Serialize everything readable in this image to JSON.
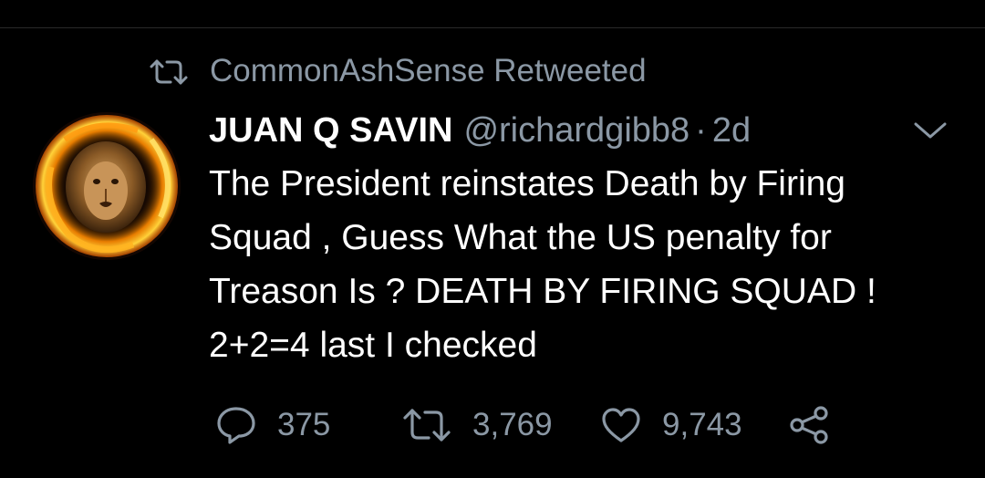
{
  "retweet_context": {
    "icon": "retweet-icon",
    "text": "CommonAshSense Retweeted"
  },
  "tweet": {
    "avatar": "lion-flame-avatar",
    "display_name": "JUAN Q SAVIN",
    "handle": "@richardgibb8",
    "separator": "·",
    "timestamp": "2d",
    "menu_icon": "chevron-down-icon",
    "text_lines": [
      "The President reinstates Death by Firing",
      "Squad , Guess What the US penalty for",
      "Treason Is ? DEATH BY FIRING SQUAD !",
      "2+2=4 last I checked"
    ]
  },
  "actions": {
    "reply": {
      "icon": "reply-icon",
      "count": "375"
    },
    "retweet": {
      "icon": "retweet-icon",
      "count": "3,769"
    },
    "like": {
      "icon": "heart-icon",
      "count": "9,743"
    },
    "share": {
      "icon": "share-icon"
    }
  },
  "colors": {
    "background": "#000000",
    "primary_text": "#ffffff",
    "secondary_text": "#8b98a5"
  }
}
